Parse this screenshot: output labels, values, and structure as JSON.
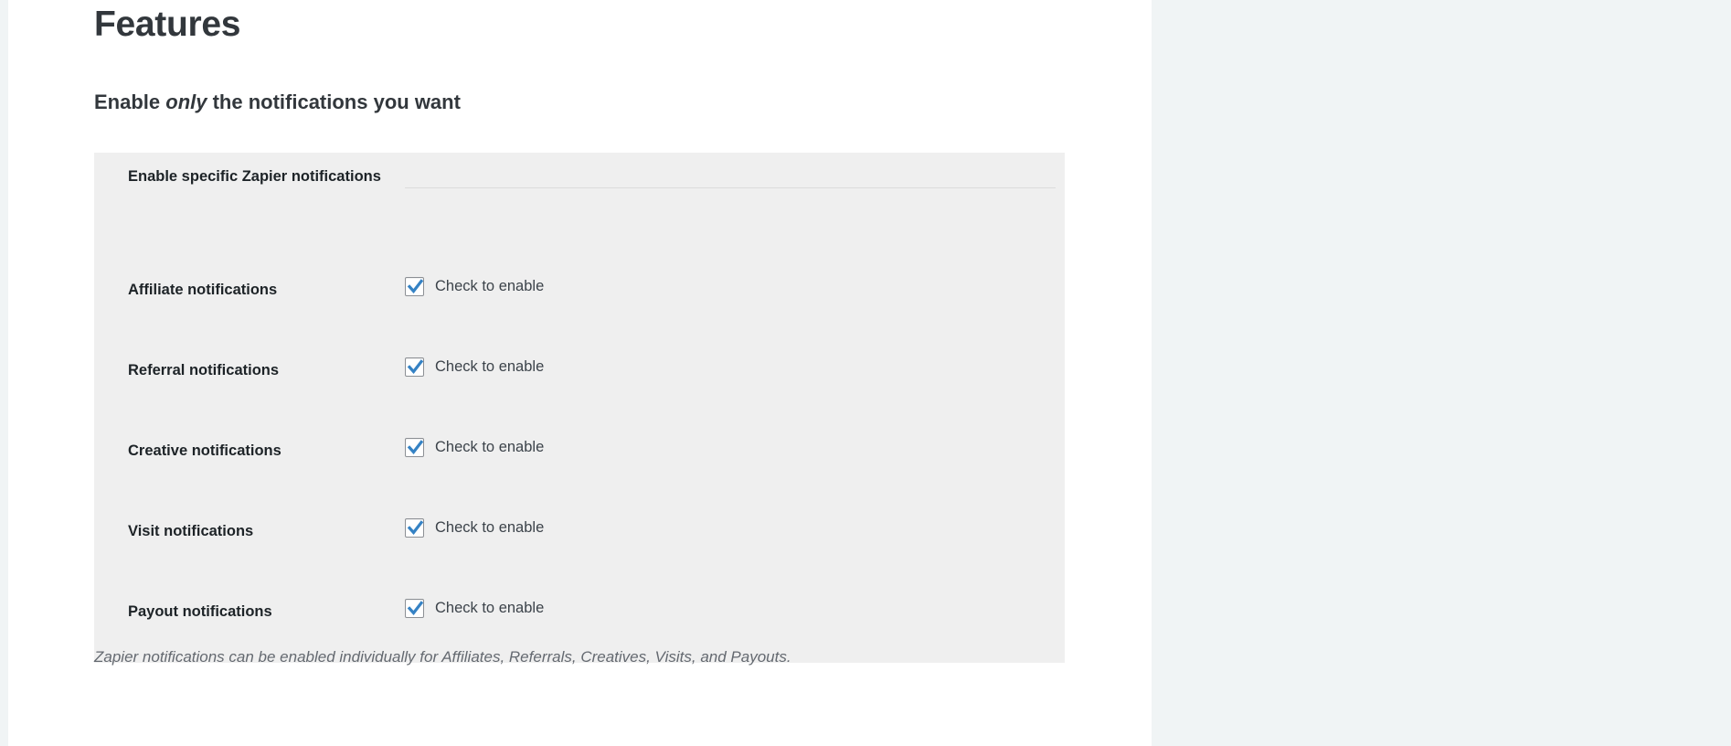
{
  "page": {
    "title": "Features",
    "subtitle_before": "Enable ",
    "subtitle_emphasis": "only",
    "subtitle_after": " the notifications you want",
    "description": "Zapier notifications can be enabled individually for Affiliates, Referrals, Creatives, Visits, and Payouts."
  },
  "settings_table": {
    "header_row": {
      "label": "Enable specific Zapier notifications"
    },
    "rows": [
      {
        "label": "Affiliate notifications",
        "checkbox_label": "Check to enable",
        "checked": true
      },
      {
        "label": "Referral notifications",
        "checkbox_label": "Check to enable",
        "checked": true
      },
      {
        "label": "Creative notifications",
        "checkbox_label": "Check to enable",
        "checked": true
      },
      {
        "label": "Visit notifications",
        "checkbox_label": "Check to enable",
        "checked": true
      },
      {
        "label": "Payout notifications",
        "checkbox_label": "Check to enable",
        "checked": true
      }
    ]
  },
  "colors": {
    "heading": "#32373c",
    "row_label": "#1d2327",
    "body_text": "#3c434a",
    "description": "#646970",
    "table_background": "#efefef",
    "checkbox_accent": "#3582c4",
    "checkbox_border": "#8c8f94",
    "page_background": "#ffffff",
    "outer_background": "#f0f4f5",
    "divider": "#dcdcdc"
  }
}
